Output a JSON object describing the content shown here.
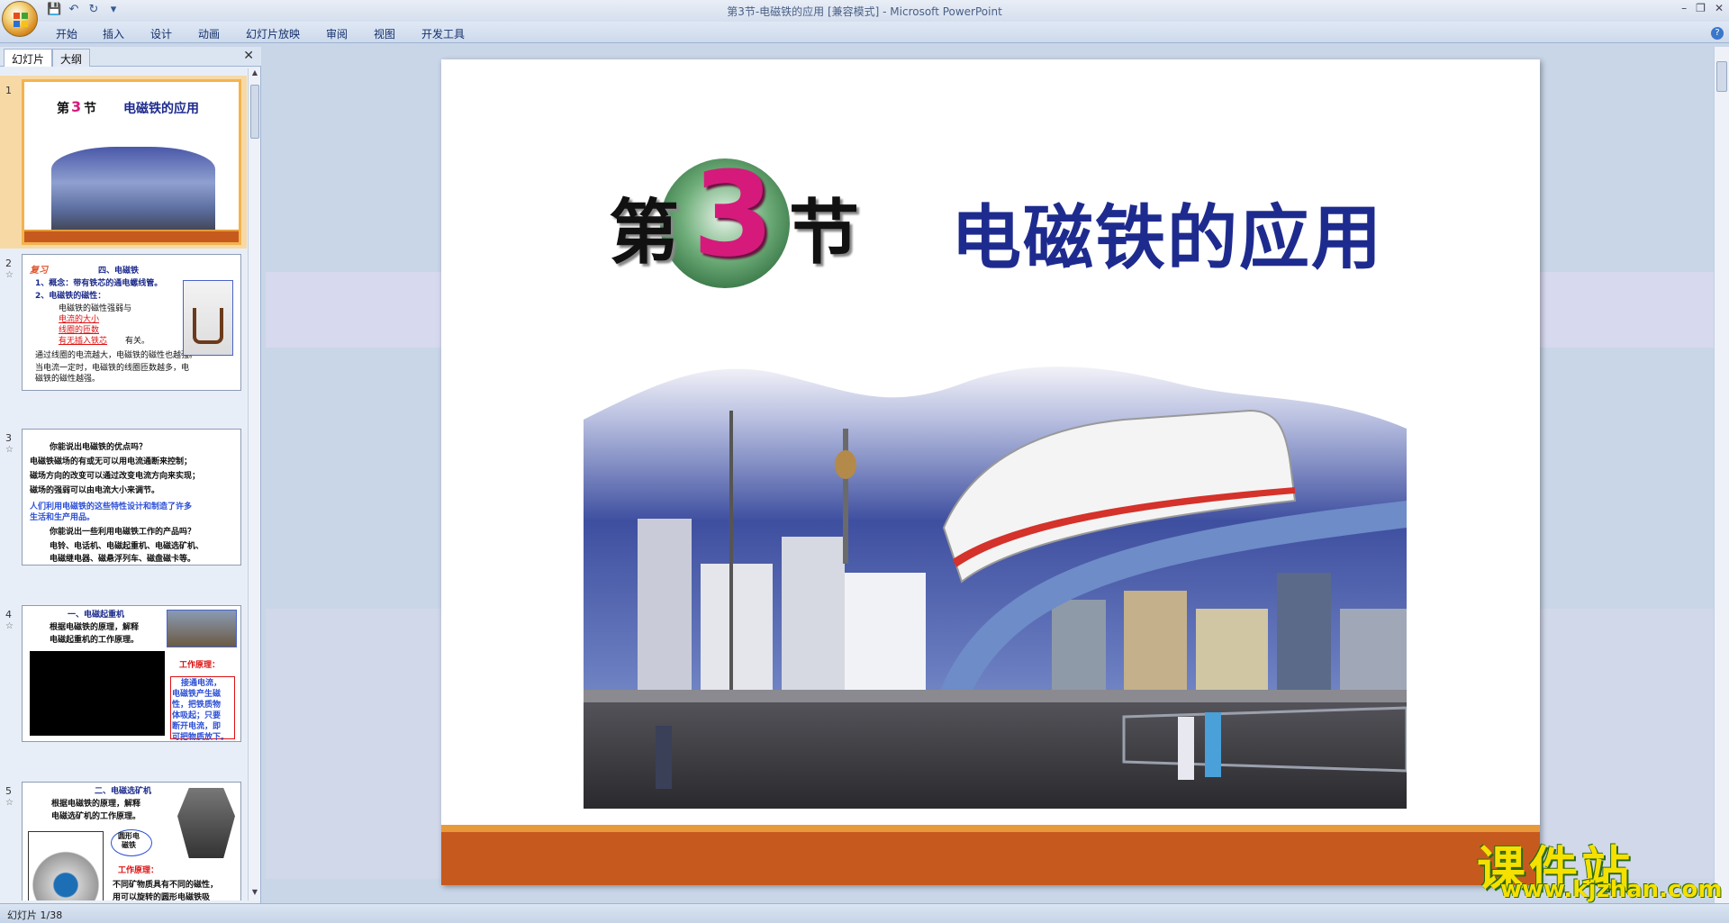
{
  "window": {
    "title": "第3节-电磁铁的应用 [兼容模式] - Microsoft PowerPoint"
  },
  "quick_access": {
    "save": "save-icon",
    "undo": "undo-icon",
    "redo": "redo-icon",
    "more": "▾"
  },
  "ribbon": {
    "tabs": [
      "开始",
      "插入",
      "设计",
      "动画",
      "幻灯片放映",
      "审阅",
      "视图",
      "开发工具"
    ]
  },
  "left_pane": {
    "tabs": [
      "幻灯片",
      "大纲"
    ]
  },
  "thumbnails": [
    {
      "num": "1",
      "title_prefix": "第",
      "title_num": "3",
      "title_suffix": "节",
      "title": "电磁铁的应用"
    },
    {
      "num": "2",
      "badge": "复习",
      "heading": "四、电磁铁",
      "lines": [
        "1、概念：带有铁芯的通电螺线管。",
        "2、电磁铁的磁性：",
        "电磁铁的磁性强弱与",
        "电流的大小",
        "线圈的匝数",
        "有无插入铁芯",
        "有关。",
        "通过线圈的电流越大，电磁铁的磁性也越强。",
        "当电流一定时，电磁铁的线圈匝数越多，电",
        "磁铁的磁性越强。"
      ]
    },
    {
      "num": "3",
      "lines": [
        "你能说出电磁铁的优点吗？",
        "电磁铁磁场的有或无可以用电流通断来控制；",
        "磁场方向的改变可以通过改变电流方向来实现；",
        "磁场的强弱可以由电流大小来调节。",
        "人们利用电磁铁的这些特性设计和制造了许多",
        "生活和生产用品。",
        "你能说出一些利用电磁铁工作的产品吗？",
        "电铃、电话机、电磁起重机、电磁选矿机、",
        "电磁继电器、磁悬浮列车、磁盘磁卡等。"
      ]
    },
    {
      "num": "4",
      "heading": "一、电磁起重机",
      "lines": [
        "根据电磁铁的原理，解释",
        "电磁起重机的工作原理。",
        "工作原理：",
        "接通电流，",
        "电磁铁产生磁",
        "性，把铁质物",
        "体吸起；只要",
        "断开电流，即",
        "可把物质放下。"
      ]
    },
    {
      "num": "5",
      "heading": "二、电磁选矿机",
      "lines": [
        "根据电磁铁的原理，解释",
        "电磁选矿机的工作原理。",
        "圆形电",
        "磁铁",
        "工作原理：",
        "不同矿物质具有不同的磁性，",
        "用可以旋转的圆形电磁铁吸"
      ]
    }
  ],
  "slide": {
    "title_prefix": "第",
    "title_num": "3",
    "title_suffix": "节",
    "title": "电磁铁的应用",
    "image": "monorail-city-photo"
  },
  "status_bar": {
    "text": "幻灯片 1/38"
  },
  "watermark": {
    "cn": "课件站",
    "url": "www.kjzhan.com"
  },
  "colors": {
    "title_blue": "#1e2b8e",
    "accent_orange": "#c65a1e",
    "thumb_selected": "#f3b34e"
  }
}
